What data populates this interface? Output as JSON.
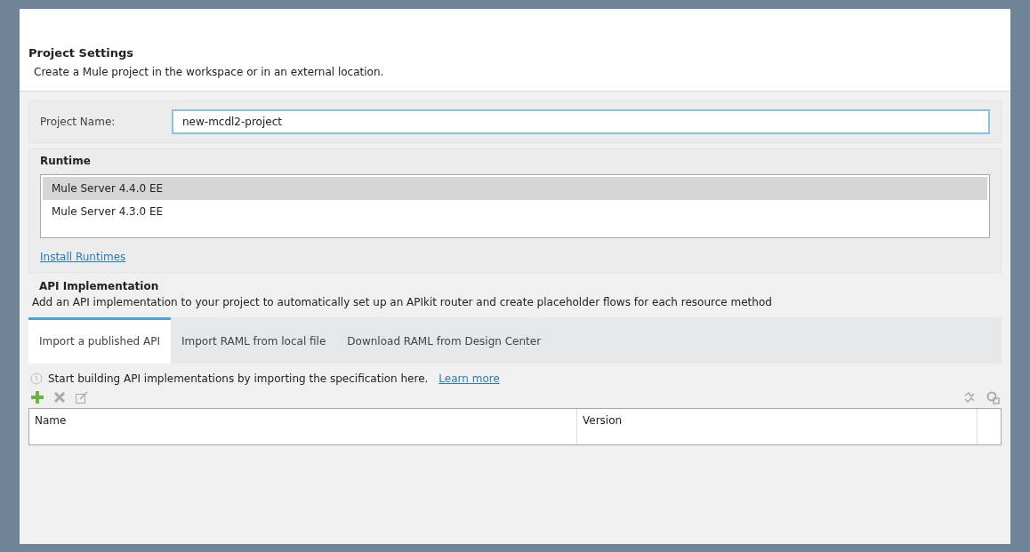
{
  "header": {
    "title": "Project Settings",
    "description": "Create a Mule project in the workspace or in an external location."
  },
  "project_name": {
    "label": "Project Name:",
    "value": "new-mcdl2-project"
  },
  "runtime": {
    "title": "Runtime",
    "items": [
      {
        "label": "Mule Server 4.4.0 EE",
        "selected": true
      },
      {
        "label": "Mule Server 4.3.0 EE",
        "selected": false
      }
    ],
    "link": "Install Runtimes"
  },
  "api_implementation": {
    "title": "API Implementation",
    "description": "Add an API implementation to your project to automatically set up an APIkit router and create placeholder flows for each resource method",
    "tabs": [
      {
        "label": "Import a published API",
        "selected": true
      },
      {
        "label": "Import RAML from local file",
        "selected": false
      },
      {
        "label": "Download RAML from Design Center",
        "selected": false
      }
    ],
    "info": "Start building API implementations by importing the specification here.",
    "info_link": "Learn more",
    "table": {
      "columns": [
        "Name",
        "Version"
      ]
    }
  }
}
